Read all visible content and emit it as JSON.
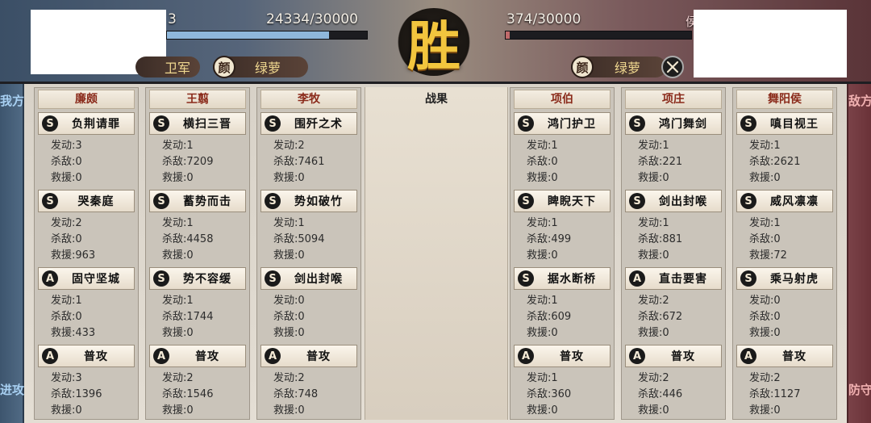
{
  "header": {
    "victory": "胜",
    "left_hp": "24334/30000",
    "left_hp_fraction": 0.811,
    "left_partial_num": "3",
    "left_unit_partial": "卫军",
    "left_hero_emblem": "颜",
    "left_hero_name": "绿萝",
    "right_hp": "374/30000",
    "right_hp_fraction": 0.012,
    "right_partial_char": "侯",
    "right_hero_emblem": "颜",
    "right_hero_name": "绿萝",
    "right_icon": "crossed-swords-icon"
  },
  "left_side": {
    "label": "我方",
    "role": "进攻"
  },
  "right_side": {
    "label": "敌方",
    "role": "防守"
  },
  "results_title": "战果",
  "stat_labels": {
    "trigger": "发动",
    "kills": "杀敌",
    "rescue": "救援"
  },
  "allies": [
    {
      "name": "廉颇",
      "skills": [
        {
          "grade": "S",
          "name": "负荆请罪",
          "trigger": "发动:3",
          "kills": "杀敌:0",
          "rescue": "救援:0"
        },
        {
          "grade": "S",
          "name": "哭秦庭",
          "trigger": "发动:2",
          "kills": "杀敌:0",
          "rescue": "救援:963"
        },
        {
          "grade": "A",
          "name": "固守坚城",
          "trigger": "发动:1",
          "kills": "杀敌:0",
          "rescue": "救援:433"
        },
        {
          "grade": "A",
          "name": "普攻",
          "trigger": "发动:3",
          "kills": "杀敌:1396",
          "rescue": "救援:0"
        }
      ]
    },
    {
      "name": "王翦",
      "skills": [
        {
          "grade": "S",
          "name": "横扫三晋",
          "trigger": "发动:1",
          "kills": "杀敌:7209",
          "rescue": "救援:0"
        },
        {
          "grade": "S",
          "name": "蓄势而击",
          "trigger": "发动:1",
          "kills": "杀敌:4458",
          "rescue": "救援:0"
        },
        {
          "grade": "S",
          "name": "势不容缓",
          "trigger": "发动:1",
          "kills": "杀敌:1744",
          "rescue": "救援:0"
        },
        {
          "grade": "A",
          "name": "普攻",
          "trigger": "发动:2",
          "kills": "杀敌:1546",
          "rescue": "救援:0"
        }
      ]
    },
    {
      "name": "李牧",
      "skills": [
        {
          "grade": "S",
          "name": "围歼之术",
          "trigger": "发动:2",
          "kills": "杀敌:7461",
          "rescue": "救援:0"
        },
        {
          "grade": "S",
          "name": "势如破竹",
          "trigger": "发动:1",
          "kills": "杀敌:5094",
          "rescue": "救援:0"
        },
        {
          "grade": "S",
          "name": "剑出封喉",
          "trigger": "发动:0",
          "kills": "杀敌:0",
          "rescue": "救援:0"
        },
        {
          "grade": "A",
          "name": "普攻",
          "trigger": "发动:2",
          "kills": "杀敌:748",
          "rescue": "救援:0"
        }
      ]
    }
  ],
  "enemies": [
    {
      "name": "项伯",
      "skills": [
        {
          "grade": "S",
          "name": "鸿门护卫",
          "trigger": "发动:1",
          "kills": "杀敌:0",
          "rescue": "救援:0"
        },
        {
          "grade": "S",
          "name": "睥睨天下",
          "trigger": "发动:1",
          "kills": "杀敌:499",
          "rescue": "救援:0"
        },
        {
          "grade": "S",
          "name": "据水断桥",
          "trigger": "发动:1",
          "kills": "杀敌:609",
          "rescue": "救援:0"
        },
        {
          "grade": "A",
          "name": "普攻",
          "trigger": "发动:1",
          "kills": "杀敌:360",
          "rescue": "救援:0"
        }
      ]
    },
    {
      "name": "项庄",
      "skills": [
        {
          "grade": "S",
          "name": "鸿门舞剑",
          "trigger": "发动:1",
          "kills": "杀敌:221",
          "rescue": "救援:0"
        },
        {
          "grade": "S",
          "name": "剑出封喉",
          "trigger": "发动:1",
          "kills": "杀敌:881",
          "rescue": "救援:0"
        },
        {
          "grade": "A",
          "name": "直击要害",
          "trigger": "发动:2",
          "kills": "杀敌:672",
          "rescue": "救援:0"
        },
        {
          "grade": "A",
          "name": "普攻",
          "trigger": "发动:2",
          "kills": "杀敌:446",
          "rescue": "救援:0"
        }
      ]
    },
    {
      "name": "舞阳侯",
      "skills": [
        {
          "grade": "S",
          "name": "嗔目视王",
          "trigger": "发动:1",
          "kills": "杀敌:2621",
          "rescue": "救援:0"
        },
        {
          "grade": "S",
          "name": "威风凛凛",
          "trigger": "发动:1",
          "kills": "杀敌:0",
          "rescue": "救援:72"
        },
        {
          "grade": "S",
          "name": "乘马射虎",
          "trigger": "发动:0",
          "kills": "杀敌:0",
          "rescue": "救援:0"
        },
        {
          "grade": "A",
          "name": "普攻",
          "trigger": "发动:2",
          "kills": "杀敌:1127",
          "rescue": "救援:0"
        }
      ]
    }
  ],
  "colors": {
    "left_hp": "#8fb7db",
    "right_hp": "#c06a6a",
    "victory": "#f2c53e"
  }
}
